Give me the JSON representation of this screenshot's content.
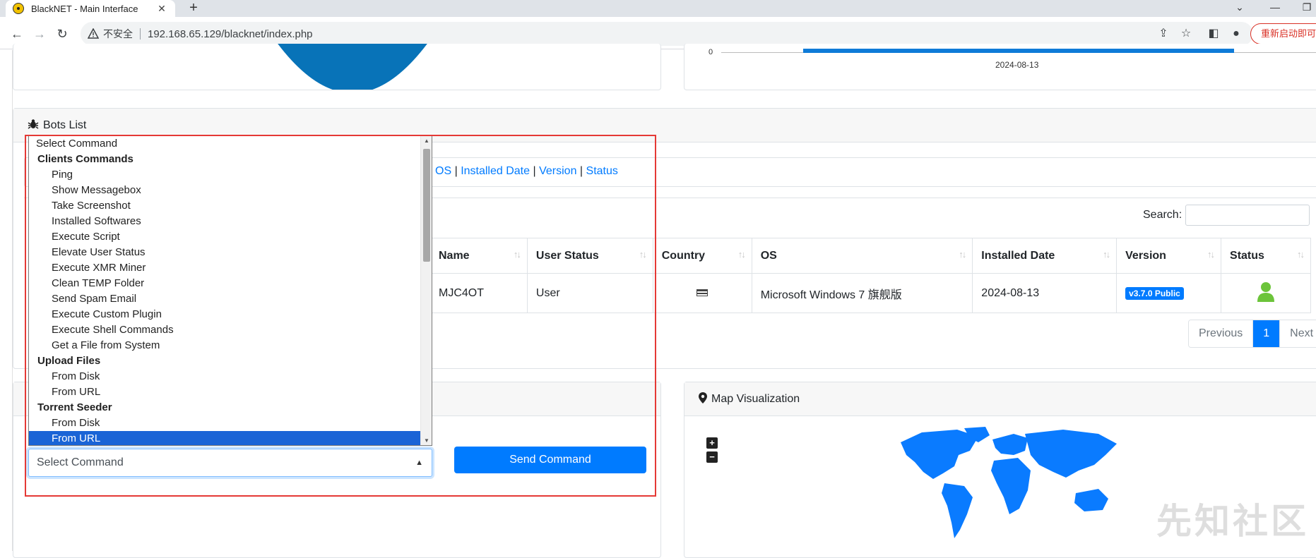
{
  "browser": {
    "tab_title": "BlackNET - Main Interface",
    "new_tab": "+",
    "insecure_label": "不安全",
    "url": "192.168.65.129/blacknet/index.php",
    "restart_label": "重新启动即可更新"
  },
  "chart_top": {
    "y_tick": "0",
    "x_label": "2024-08-13"
  },
  "bots_card": {
    "title": "Bots List",
    "column_toggles": [
      "OS",
      "Installed Date",
      "Version",
      "Status"
    ],
    "toggle_sep": "|",
    "search_label": "Search:",
    "columns": [
      "Name",
      "User Status",
      "Country",
      "OS",
      "Installed Date",
      "Version",
      "Status"
    ],
    "rows": [
      {
        "name": "MJC4OT",
        "user_status": "User",
        "os": "Microsoft Windows 7 旗舰版",
        "installed": "2024-08-13",
        "version": "v3.7.0 Public"
      }
    ],
    "pagination": {
      "previous": "Previous",
      "page": "1",
      "next": "Next"
    }
  },
  "command": {
    "selected": "Select Command",
    "send_label": "Send Command",
    "options": [
      {
        "type": "top",
        "label": "Select Command"
      },
      {
        "type": "group",
        "label": "Clients Commands"
      },
      {
        "type": "option",
        "label": "Ping"
      },
      {
        "type": "option",
        "label": "Show Messagebox"
      },
      {
        "type": "option",
        "label": "Take Screenshot"
      },
      {
        "type": "option",
        "label": "Installed Softwares"
      },
      {
        "type": "option",
        "label": "Execute Script"
      },
      {
        "type": "option",
        "label": "Elevate User Status"
      },
      {
        "type": "option",
        "label": "Execute XMR Miner"
      },
      {
        "type": "option",
        "label": "Clean TEMP Folder"
      },
      {
        "type": "option",
        "label": "Send Spam Email"
      },
      {
        "type": "option",
        "label": "Execute Custom Plugin"
      },
      {
        "type": "option",
        "label": "Execute Shell Commands"
      },
      {
        "type": "option",
        "label": "Get a File from System"
      },
      {
        "type": "group",
        "label": "Upload Files"
      },
      {
        "type": "option",
        "label": "From Disk"
      },
      {
        "type": "option",
        "label": "From URL"
      },
      {
        "type": "group",
        "label": "Torrent Seeder"
      },
      {
        "type": "option",
        "label": "From Disk"
      },
      {
        "type": "option",
        "label": "From URL",
        "selected": true
      }
    ]
  },
  "map_card": {
    "title": "Map Visualization",
    "zoom_in": "+",
    "zoom_out": "−",
    "map_color": "#0a7bff"
  },
  "watermark": "先知社区",
  "colors": {
    "accent": "#007bff",
    "highlight": "#e53935"
  }
}
